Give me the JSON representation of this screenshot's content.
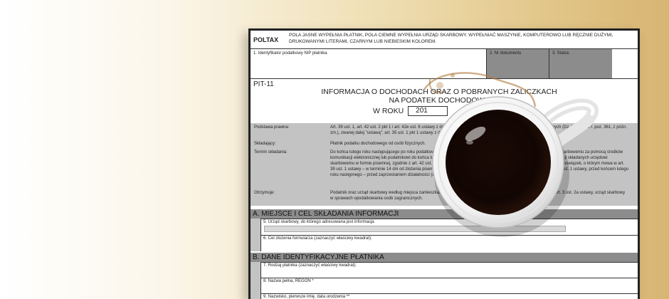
{
  "header": {
    "brand": "POLTAX",
    "note": "POLA JASNE WYPEŁNIA PŁATNIK, POLA CIEMNE WYPEŁNIA URZĄD SKARBOWY. WYPEŁNIAĆ MASZYNIE, KOMPUTEROWO LUB RĘCZNIE DUŻYMI, DRUKOWANYMI LITERAMI, CZARNYM LUB NIEBIESKIM KOLOREM."
  },
  "ids": {
    "nip": "1. Identyfikator podatkowy NIP płatnika",
    "doc": "2. Nr dokumentu",
    "status": "3. Status"
  },
  "title": {
    "code": "PIT-11",
    "line1": "INFORMACJA O DOCHODACH ORAZ O POBRANYCH ZALICZKACH",
    "line2": "NA PODATEK DOCHODOWY",
    "year_label": "W ROKU",
    "year_value": "201"
  },
  "info": {
    "basis_label": "Podstawa prawna:",
    "basis_text": "Art. 39 ust. 1, art. 42 ust. 2 pkt 1 i art. 42e ust. 6 ustawy z dnia 26 lipca 1991 r. o podatku dochodowym od osób fizycznych (Dz. U. z 2012 r. poz. 361, z późn. zm.), zwanej dalej \"ustawą\"; art. 35 ust. 1 pkt 1 ustawy z dnia ... (Dz. U. z ... 16 października 2007 r. 1).",
    "filer_label": "Składający:",
    "filer_text": "Płatnik podatku dochodowego od osób fizycznych.",
    "deadline_label": "Termin składania:",
    "deadline_text": "Do końca lutego roku następującego po roku podatkowym – urzędowi skarbowemu, a w przypadku przesyłania urzędowi skarbowemu za pomocą środków komunikacji elektronicznej lub podatnikowi do końca lutego roku następującego po roku podatkowym; w przypadku informacji składanych urzędowi skarbowemu w formie pisemnej, zgodnie z art. 42 ust. 2 pkt 1 ustawy. W przypadku gdy w trakcie roku podatkowego ustał obowiązek, o którym mowa w art. 39 ust. 1 ustawy – w terminie 14 dni od złożenia pisemnego wniosku podatnika, przez płatników, o których mowa w art. 41 ust. 1 ustawy, przed końcem lutego roku następnego – przed zaprzestaniem działalności (dniem zaprzestania tej działalności).",
    "recipient_label": "Otrzymuje:",
    "recipient_text": "Podatnik oraz urząd skarbowy według miejsca zamieszkania podatnika, a w przypadku podatników, o których mowa w art. 3 ust. 2a ustawy, urząd skarbowy w sprawach opodatkowania osób zagranicznych."
  },
  "sectionA": {
    "title": "A. MIEJSCE I CEL SKŁADANIA INFORMACJI",
    "f5": "5. Urząd skarbowy, do którego adresowana jest informacja",
    "f6": "6. Cel złożenia formularza (zaznaczyć właściwy kwadrat):"
  },
  "sectionB": {
    "title": "B. DANE IDENTYFIKACYJNE PŁATNIKA",
    "f7": "7. Rodzaj płatnika (zaznaczyć właściwy kwadrat):",
    "f8": "8. Nazwa pełna, REGON *",
    "f9": "9. Nazwisko, pierwsze imię, data urodzenia **"
  }
}
